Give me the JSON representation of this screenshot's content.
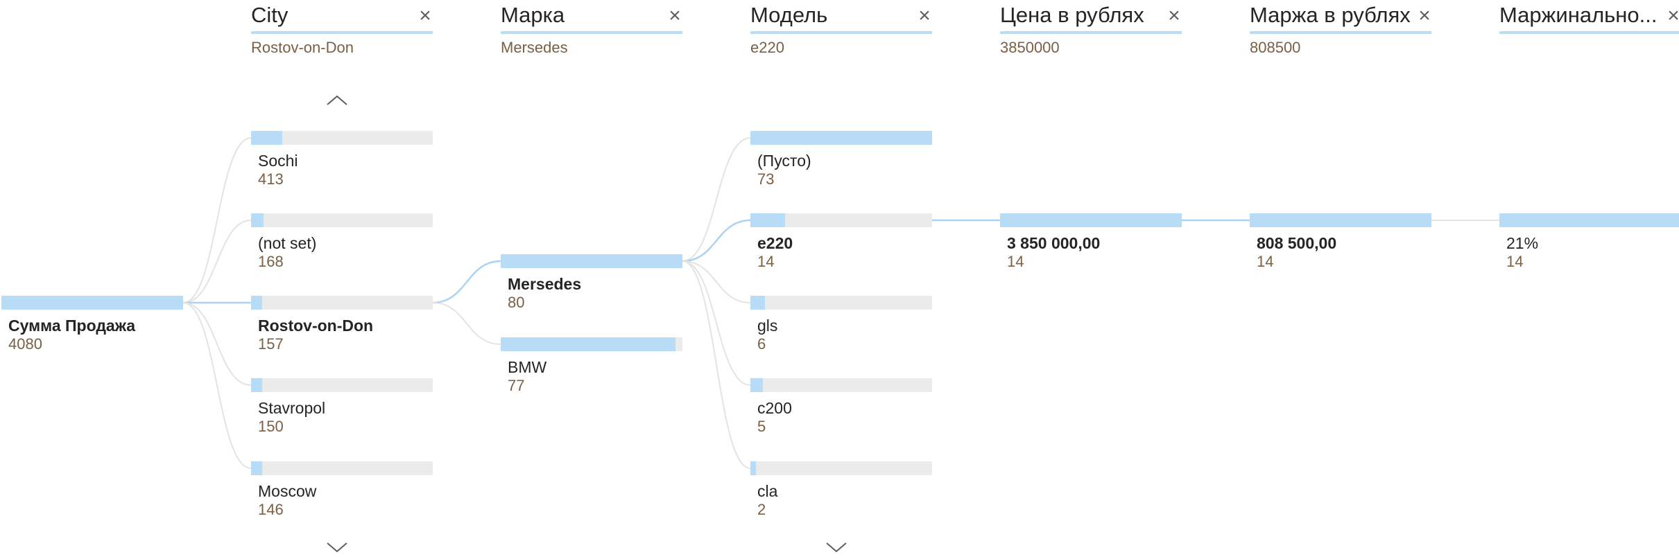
{
  "root": {
    "label": "Сумма Продажа",
    "value": "4080",
    "fill": 1.0
  },
  "columns": [
    {
      "id": "city",
      "title": "City",
      "filter": "Rostov-on-Don",
      "nodes": [
        {
          "label": "Sochi",
          "value": "413",
          "fill": 0.17,
          "selected": false
        },
        {
          "label": "(not set)",
          "value": "168",
          "fill": 0.07,
          "selected": false
        },
        {
          "label": "Rostov-on-Don",
          "value": "157",
          "fill": 0.06,
          "selected": true
        },
        {
          "label": "Stavropol",
          "value": "150",
          "fill": 0.06,
          "selected": false
        },
        {
          "label": "Moscow",
          "value": "146",
          "fill": 0.06,
          "selected": false
        }
      ]
    },
    {
      "id": "brand",
      "title": "Марка",
      "filter": "Mersedes",
      "nodes": [
        {
          "label": "Mersedes",
          "value": "80",
          "fill": 1.0,
          "selected": true
        },
        {
          "label": "BMW",
          "value": "77",
          "fill": 0.96,
          "selected": false
        }
      ]
    },
    {
      "id": "model",
      "title": "Модель",
      "filter": "e220",
      "nodes": [
        {
          "label": "(Пусто)",
          "value": "73",
          "fill": 1.0,
          "selected": false
        },
        {
          "label": "e220",
          "value": "14",
          "fill": 0.19,
          "selected": true
        },
        {
          "label": "gls",
          "value": "6",
          "fill": 0.08,
          "selected": false
        },
        {
          "label": "c200",
          "value": "5",
          "fill": 0.07,
          "selected": false
        },
        {
          "label": "cla",
          "value": "2",
          "fill": 0.03,
          "selected": false
        }
      ]
    },
    {
      "id": "price",
      "title": "Цена в рублях",
      "filter": "3850000",
      "nodes": [
        {
          "label": "3 850 000,00",
          "value": "14",
          "fill": 1.0,
          "selected": true
        }
      ]
    },
    {
      "id": "margin",
      "title": "Маржа в рублях",
      "filter": "808500",
      "nodes": [
        {
          "label": "808 500,00",
          "value": "14",
          "fill": 1.0,
          "selected": true
        }
      ]
    },
    {
      "id": "marginality",
      "title": "Маржинально...",
      "filter": "",
      "nodes": [
        {
          "label": "21%",
          "value": "14",
          "fill": 1.0,
          "selected": false
        }
      ]
    }
  ],
  "icons": {
    "close": "close-icon",
    "up": "chevron-up-icon",
    "down": "chevron-down-icon"
  },
  "colors": {
    "bar_fill": "#b9dcf6",
    "bar_track": "#ebebeb",
    "link_active": "#a9d3f5",
    "link_inactive": "#e3e3e3"
  }
}
